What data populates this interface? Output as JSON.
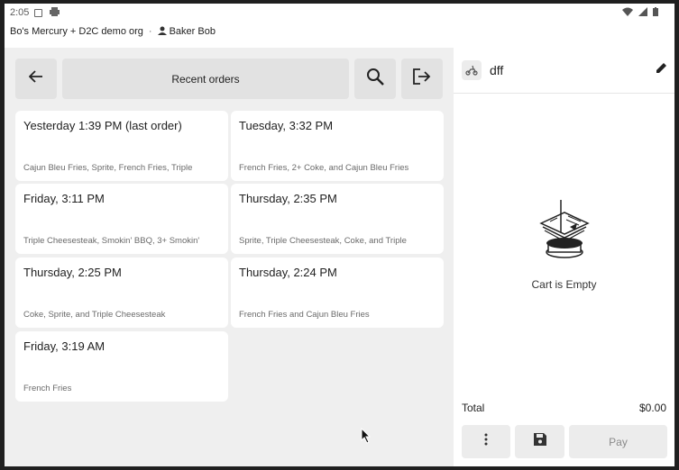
{
  "status_bar": {
    "time": "2:05"
  },
  "org_line": {
    "org": "Bo's Mercury + D2C demo org",
    "separator": "·",
    "user": "Baker Bob"
  },
  "toolbar": {
    "title": "Recent orders",
    "icons": {
      "back": "arrow-left-icon",
      "search": "search-icon",
      "exit": "logout-icon"
    }
  },
  "orders": [
    {
      "title": "Yesterday 1:39 PM (last order)",
      "items": "Cajun Bleu Fries, Sprite, French Fries, Triple"
    },
    {
      "title": "Tuesday, 3:32 PM",
      "items": "French Fries, 2+ Coke, and Cajun Bleu Fries"
    },
    {
      "title": "Friday, 3:11 PM",
      "items": "Triple Cheesesteak, Smokin' BBQ, 3+ Smokin'"
    },
    {
      "title": "Thursday, 2:35 PM",
      "items": "Sprite, Triple Cheesesteak, Coke, and Triple"
    },
    {
      "title": "Thursday, 2:25 PM",
      "items": "Coke, Sprite, and Triple Cheesesteak"
    },
    {
      "title": "Thursday, 2:24 PM",
      "items": "French Fries and Cajun Bleu Fries"
    },
    {
      "title": "Friday, 3:19 AM",
      "items": "French Fries"
    }
  ],
  "cart": {
    "customer": "dff",
    "empty_label": "Cart is Empty",
    "total_label": "Total",
    "total_value": "$0.00",
    "pay_label": "Pay",
    "icons": {
      "customer": "scooter-icon",
      "edit": "pencil-icon",
      "more": "more-vertical-icon",
      "save": "save-icon",
      "empty": "empty-cart-illustration"
    }
  },
  "colors": {
    "left_bg": "#efefef",
    "button_bg": "#e2e2e2",
    "card_bg": "#ffffff",
    "pay_text": "#8a8a8a"
  }
}
